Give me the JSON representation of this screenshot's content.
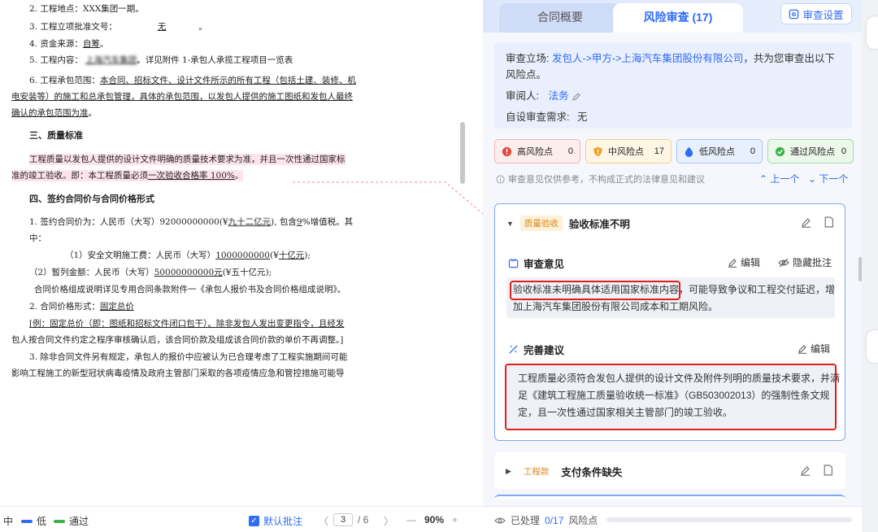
{
  "doc": {
    "lines": [
      "2. 工程地点：XXX集团一期。",
      "3. 工程立项批准文号：",
      "无",
      "。",
      "4. 资金来源：",
      "自筹",
      "。",
      "5. 工程内容：",
      "上海汽车集团",
      "。详见附件 1-承包人承揽工程项目一览表",
      "6. 工程承包范围：",
      "本合同、招标文件、设计文件所示的所有工程（包括土建、装修、机",
      "电安装等）的施工和总承包管理，具体的承包范围，以发包人提供的施工图纸和发包人最终",
      "确认的承包范围为准",
      "。",
      "三、质量标准",
      "工程质量以发包人提供的设计文件明确的质量技术要求为准，并且一次性通过国家标",
      "准的竣工验收。即：本工程质量必须",
      "一次验收合格率 100%",
      "。",
      "四、签约合同价与合同价格形式",
      "1. 签约合同价为：人民币（大写）92000000000(¥",
      "九十二亿元",
      "), 包含",
      "9",
      "%增值税。其",
      "中：",
      "（1）安全文明施工费：人民币（大写）",
      "1000000000",
      "(¥",
      "十亿元",
      ");",
      "（2）暂列金额：人民币（大写）",
      "50000000000",
      "元",
      "(¥五十亿",
      "元);",
      "合同价格组成说明详见专用合同条款附件一《承包人报价书及合同价格组成说明》。",
      "2. 合同价格形式：",
      "固定总价",
      "[例：固定总价（即：图纸和招标文件闭口包干）。除非发包人发出变更指令，且经发",
      "包人按合同文件约定之程序审核确认后，该合同价款及组成该合同价款的单价不再调整。]",
      "3. 除非合同文件另有规定，承包人的报价中应被认为已合理考虑了工程实施期间可能",
      "影响工程施工的新型冠状病毒疫情及政府主管部门采取的各项疫情应急和管控措施可能导"
    ]
  },
  "doc_footer": {
    "legend_mid": "中",
    "legend_low": "低",
    "legend_pass": "通过",
    "default_annotation": "默认批注",
    "page_current": "3",
    "page_total": "/ 6",
    "zoom": "90%",
    "zoom_out": "—",
    "zoom_in": "+",
    "prev": "〈",
    "next": "〉"
  },
  "tabs": {
    "contract_overview": "合同概要",
    "risk_review": "风险审查 (17)",
    "settings": "审查设置"
  },
  "info": {
    "stance_label": "审查立场:",
    "stance_value": "发包人->甲方->上海汽车集团股份有限公司",
    "stance_suffix": "，共为您审查出以下风险点。",
    "reviewer_label": "审阅人:",
    "reviewer_value": "法务",
    "custom_label": "自设审查需求:",
    "custom_value": "无"
  },
  "risk_levels": [
    {
      "label": "高风险点",
      "count": "0"
    },
    {
      "label": "中风险点",
      "count": "17"
    },
    {
      "label": "低风险点",
      "count": "0"
    },
    {
      "label": "通过风险点",
      "count": "0"
    }
  ],
  "colors": {
    "high": "#e8453c",
    "mid": "#f0a020",
    "low": "#2f6cf6",
    "pass": "#3bb54a",
    "accent": "#2f6cf6"
  },
  "disclaimer": "审查意见仅供参考，不构成正式的法律意见和建议",
  "nav": {
    "prev": "上一个",
    "next": "下一个"
  },
  "card1": {
    "tag": "质量验收",
    "title": "验收标准不明",
    "opinion_title": "审查意见",
    "edit": "编辑",
    "hide": "隐藏批注",
    "opinion_highlight": "验收标准未明确具体适用国家标准内容",
    "opinion_rest1": "，可能导致争议和工程交付延迟，增",
    "opinion_rest2": "加上海汽车集团股份有限公司成本和工期风险。",
    "suggest_title": "完善建议",
    "suggest_edit": "编辑",
    "suggest_line1": "工程质量必须符合发包人提供的设计文件及附件列明的质量技术要求，并满",
    "suggest_line2": "足《建筑工程施工质量验收统一标准》（GB503002013）的强制性条文规",
    "suggest_line3": "定，且一次性通过国家相关主管部门的竣工验收。"
  },
  "card2": {
    "tag": "工程款",
    "title": "支付条件缺失"
  },
  "panel_footer": {
    "processed_label": "已处理",
    "processed_value": "0/17",
    "processed_suffix": "风险点",
    "progress": 0
  }
}
